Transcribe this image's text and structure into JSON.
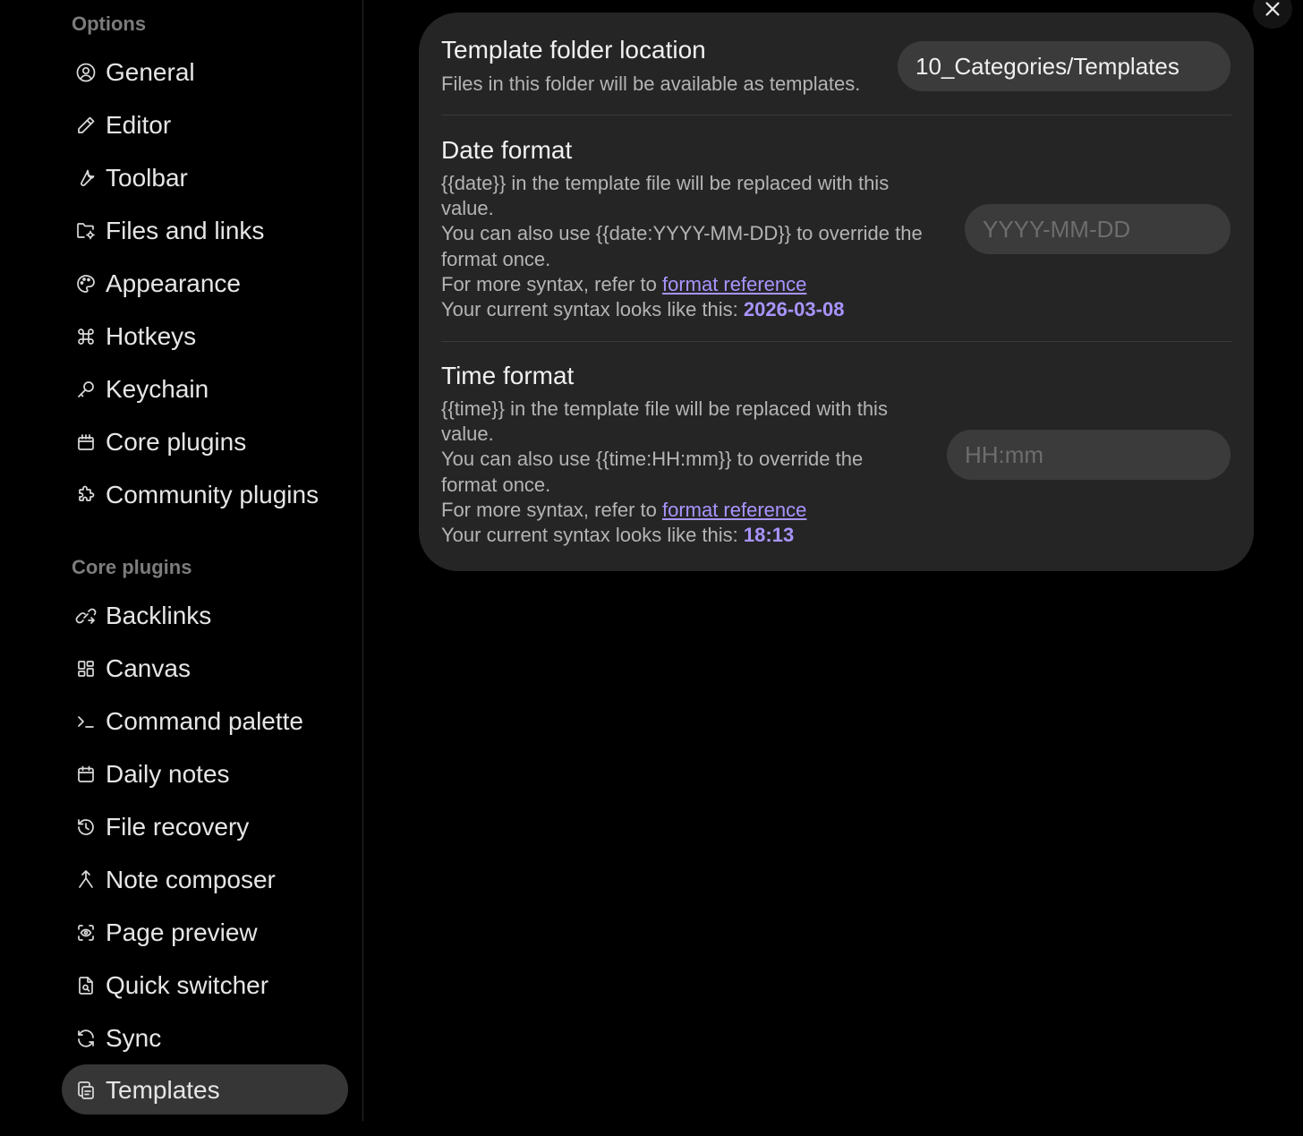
{
  "sidebar": {
    "options_title": "Options",
    "options": [
      {
        "label": "General",
        "icon": "user-circle-icon"
      },
      {
        "label": "Editor",
        "icon": "pencil-icon"
      },
      {
        "label": "Toolbar",
        "icon": "wrench-icon"
      },
      {
        "label": "Files and links",
        "icon": "folder-cog-icon"
      },
      {
        "label": "Appearance",
        "icon": "palette-icon"
      },
      {
        "label": "Hotkeys",
        "icon": "command-icon"
      },
      {
        "label": "Keychain",
        "icon": "key-icon"
      },
      {
        "label": "Core plugins",
        "icon": "calendar-box-icon"
      },
      {
        "label": "Community plugins",
        "icon": "puzzle-icon"
      }
    ],
    "core_title": "Core plugins",
    "core": [
      {
        "label": "Backlinks",
        "icon": "link-arrow-icon"
      },
      {
        "label": "Canvas",
        "icon": "layout-dashboard-icon"
      },
      {
        "label": "Command palette",
        "icon": "terminal-icon"
      },
      {
        "label": "Daily notes",
        "icon": "calendar-icon"
      },
      {
        "label": "File recovery",
        "icon": "history-icon"
      },
      {
        "label": "Note composer",
        "icon": "merge-icon"
      },
      {
        "label": "Page preview",
        "icon": "scan-eye-icon"
      },
      {
        "label": "Quick switcher",
        "icon": "file-search-icon"
      },
      {
        "label": "Sync",
        "icon": "refresh-icon"
      },
      {
        "label": "Templates",
        "icon": "copy-icon",
        "active": true
      }
    ]
  },
  "settings": {
    "folder": {
      "name": "Template folder location",
      "desc": "Files in this folder will be available as templates.",
      "value": "10_Categories/Templates"
    },
    "date": {
      "name": "Date format",
      "line1": "{{date}} in the template file will be replaced with this",
      "line2": "value.",
      "line3": "You can also use {{date:YYYY-MM-DD}} to override the",
      "line4": "format once.",
      "ref_prefix": "For more syntax, refer to ",
      "ref_link": "format reference",
      "current_prefix": "Your current syntax looks like this: ",
      "current_value": "2026-03-08",
      "placeholder": "YYYY-MM-DD"
    },
    "time": {
      "name": "Time format",
      "line1": "{{time}} in the template file will be replaced with this",
      "line2": "value.",
      "line3": "You can also use {{time:HH:mm}} to override the",
      "line4": "format once.",
      "ref_prefix": "For more syntax, refer to ",
      "ref_link": "format reference",
      "current_prefix": "Your current syntax looks like this: ",
      "current_value": "18:13",
      "placeholder": "HH:mm"
    }
  },
  "colors": {
    "accent": "#a994ff",
    "panel": "#252525",
    "active_item": "#363636"
  }
}
